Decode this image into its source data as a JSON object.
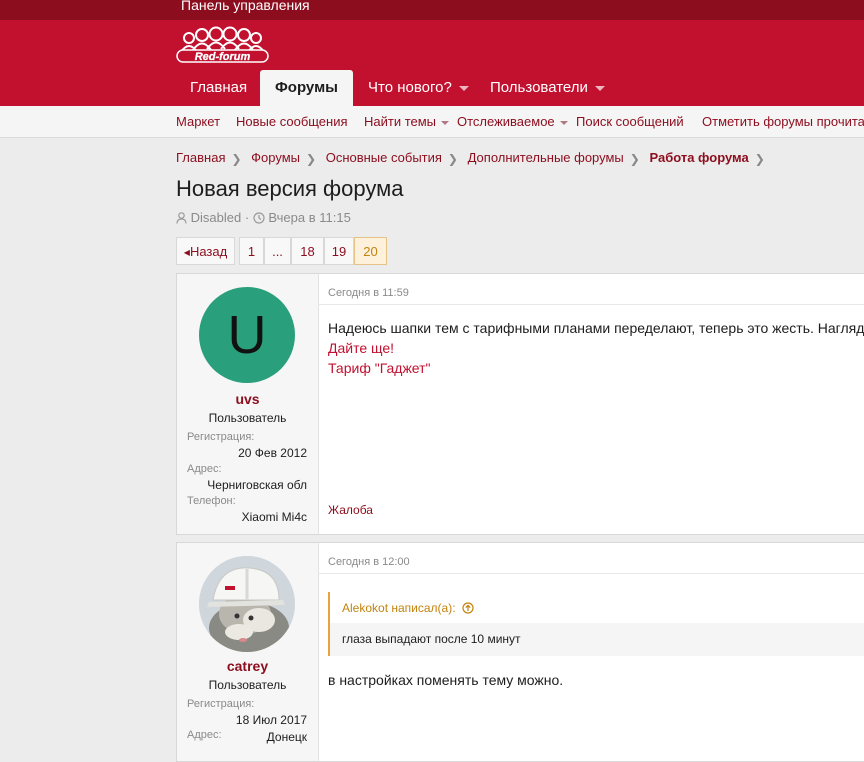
{
  "topbar": {
    "control_panel": "Панель управления"
  },
  "nav": {
    "home": "Главная",
    "forums": "Форумы",
    "whats_new": "Что нового?",
    "members": "Пользователи"
  },
  "subnav": {
    "market": "Маркет",
    "new_posts": "Новые сообщения",
    "find_threads": "Найти темы",
    "watched": "Отслеживаемое",
    "search_posts": "Поиск сообщений",
    "mark_read": "Отметить форумы прочитанными"
  },
  "breadcrumbs": [
    "Главная",
    "Форумы",
    "Основные события",
    "Дополнительные форумы",
    "Работа форума"
  ],
  "thread": {
    "title": "Новая версия форума",
    "author": "Disabled",
    "date": "Вчера в 11:15"
  },
  "pagination": {
    "prev": "Назад",
    "pages": [
      "1",
      "...",
      "18",
      "19",
      "20"
    ],
    "current": "20"
  },
  "posts": [
    {
      "avatar_letter": "U",
      "avatar_color": "#2a9f7c",
      "username": "uvs",
      "user_title": "Пользователь",
      "reg_label": "Регистрация:",
      "reg_value": "20 Фев 2012",
      "addr_label": "Адрес:",
      "addr_value": "Черниговская обл",
      "phone_label": "Телефон:",
      "phone_value": "Xiaomi Mi4c",
      "date": "Сегодня в 11:59",
      "text": "Надеюсь шапки тем с тарифными планами переделают, теперь это жесть. Наглядно",
      "line2": "Дайте ще!",
      "line3": "Тариф \"Гаджет\"",
      "report": "Жалоба"
    },
    {
      "avatar_icon": "cat-in-helmet-avatar",
      "username": "catrey",
      "user_title": "Пользователь",
      "reg_label": "Регистрация:",
      "reg_value": "18 Июл 2017",
      "addr_label": "Адрес:",
      "addr_value": "Донецк",
      "date": "Сегодня в 12:00",
      "quote_author": "Alekokot написал(а):",
      "quote_text": "глаза выпадают после 10 минут",
      "text": "в настройках поменять тему можно."
    }
  ],
  "colors": {
    "brand": "#c2102f",
    "brand_dark": "#8c0d1e",
    "accent": "#e8a33d"
  }
}
